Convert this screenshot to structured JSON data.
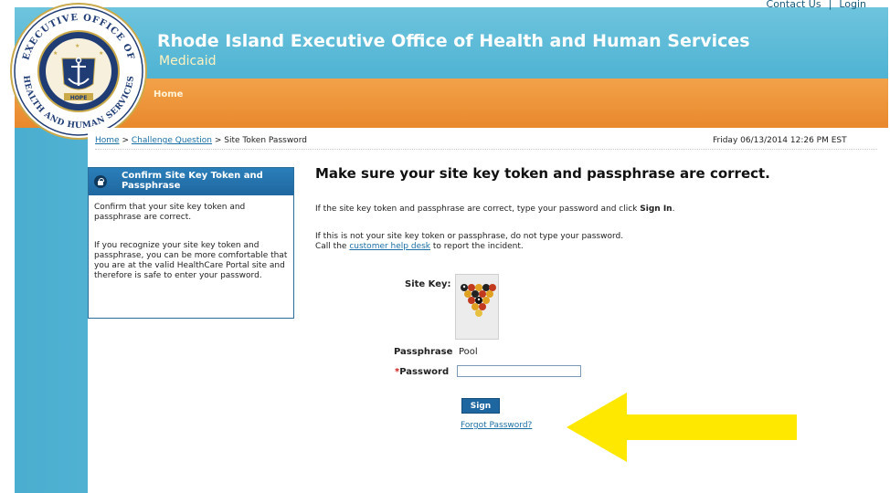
{
  "header": {
    "title": "Rhode Island Executive Office of Health and Human Services",
    "subtitle": "Medicaid",
    "top_links": [
      "Contact Us",
      "Login"
    ],
    "top_separator": "|",
    "seal_text": {
      "top": "EXECUTIVE OFFICE OF",
      "bottom": "HEALTH AND HUMAN SERVICES",
      "hope": "HOPE"
    }
  },
  "nav": {
    "home_tab": "Home"
  },
  "breadcrumb": {
    "items": [
      "Home",
      "Challenge Question",
      "Site Token Password"
    ],
    "separator": ">"
  },
  "datetime": "Friday 06/13/2014 12:26 PM EST",
  "infobox": {
    "title": "Confirm Site Key Token and Passphrase",
    "paragraph1": "Confirm that your site key token and passphrase are correct.",
    "paragraph2": "If you recognize your site key token and passphrase, you can be more comfortable that you are at the valid HealthCare Portal site and therefore is safe to enter your password."
  },
  "main": {
    "heading": "Make sure your site key token and passphrase are correct.",
    "line1_prefix": "If the site key token and passphrase are correct, type your password and click",
    "line1_bold": "Sign In",
    "line1_suffix": ".",
    "line2": "If this is not your site key token or passphrase, do not type your password.",
    "line3_prefix": "Call the",
    "line3_link": "customer help desk",
    "line3_suffix": "to report the incident.",
    "site_key_label": "Site Key:",
    "passphrase_label": "Passphrase",
    "passphrase_value": "Pool",
    "password_required_mark": "*",
    "password_label": "Password",
    "password_value": "",
    "sign_in_label": "Sign In",
    "forgot_password_label": "Forgot Password?"
  },
  "colors": {
    "header_blue": "#4fb3d3",
    "orange_bar": "#e9882c",
    "link_blue": "#1b6fa6",
    "button_blue": "#1e66a0",
    "arrow_yellow": "#ffe800"
  },
  "icons": {
    "infobox_icon": "lock-icon",
    "site_key_image": "billiard-balls-rack",
    "annotation": "arrow-left-icon"
  }
}
